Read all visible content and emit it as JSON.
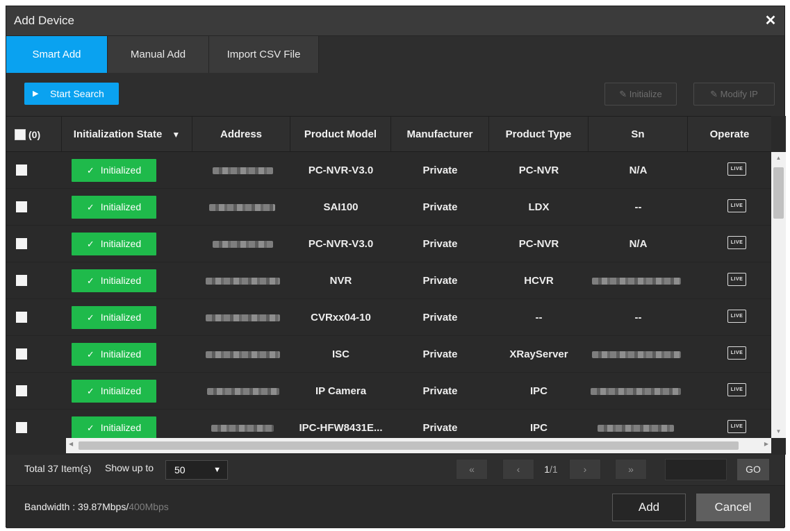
{
  "dialog": {
    "title": "Add Device",
    "close_icon": "close-icon"
  },
  "tabs": [
    {
      "label": "Smart Add",
      "active": true
    },
    {
      "label": "Manual Add",
      "active": false
    },
    {
      "label": "Import CSV File",
      "active": false
    }
  ],
  "toolbar": {
    "start_search": "Start Search",
    "initialize": "Initialize",
    "modify_ip": "Modify IP"
  },
  "table": {
    "selected_count": "(0)",
    "columns": [
      "Initialization State",
      "Address",
      "Product Model",
      "Manufacturer",
      "Product Type",
      "Sn",
      "Operate"
    ],
    "live_label": "LIVE",
    "rows": [
      {
        "state": "Initialized",
        "address_blurred": true,
        "model": "PC-NVR-V3.0",
        "manufacturer": "Private",
        "type": "PC-NVR",
        "sn": "N/A"
      },
      {
        "state": "Initialized",
        "address_blurred": true,
        "model": "SAI100",
        "manufacturer": "Private",
        "type": "LDX",
        "sn": "--"
      },
      {
        "state": "Initialized",
        "address_blurred": true,
        "model": "PC-NVR-V3.0",
        "manufacturer": "Private",
        "type": "PC-NVR",
        "sn": "N/A"
      },
      {
        "state": "Initialized",
        "address_blurred": true,
        "model": "NVR",
        "manufacturer": "Private",
        "type": "HCVR",
        "sn": ""
      },
      {
        "state": "Initialized",
        "address_blurred": true,
        "model": "CVRxx04-10",
        "manufacturer": "Private",
        "type": "--",
        "sn": "--"
      },
      {
        "state": "Initialized",
        "address_blurred": true,
        "model": "ISC",
        "manufacturer": "Private",
        "type": "XRayServer",
        "sn": ""
      },
      {
        "state": "Initialized",
        "address_blurred": true,
        "model": "IP Camera",
        "manufacturer": "Private",
        "type": "IPC",
        "sn": ""
      },
      {
        "state": "Initialized",
        "address_blurred": true,
        "model": "IPC-HFW8431E...",
        "manufacturer": "Private",
        "type": "IPC",
        "sn": ""
      }
    ]
  },
  "pagination": {
    "total": "Total 37 Item(s)",
    "show_up_to": "Show up to",
    "page_size": "50",
    "first": "«",
    "prev": "‹",
    "current_page": "1",
    "page_sep": "/1",
    "next": "›",
    "last": "»",
    "go": "GO"
  },
  "footer": {
    "bandwidth_label": "Bandwidth  : 39.87Mbps/",
    "bandwidth_max": "400Mbps",
    "add": "Add",
    "cancel": "Cancel"
  }
}
